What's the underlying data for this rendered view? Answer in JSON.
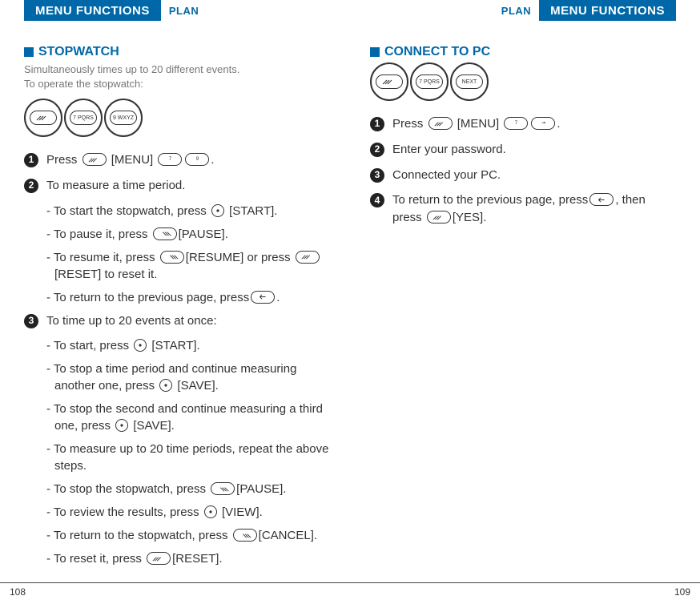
{
  "header": {
    "menu_functions": "MENU FUNCTIONS",
    "plan": "PLAN"
  },
  "left": {
    "title": "STOPWATCH",
    "intro1": "Simultaneously times up to 20 different events.",
    "intro2": "To operate the stopwatch:",
    "step1": {
      "prefix": "Press",
      "mid": "[MENU]",
      "suffix": "."
    },
    "step2": "To measure a time period.",
    "s2a_pre": "- To start the stopwatch, press ",
    "s2a_post": " [START].",
    "s2b_pre": "- To pause it, press ",
    "s2b_post": "[PAUSE].",
    "s2c_pre": "- To resume it, press ",
    "s2c_mid": "[RESUME] or press ",
    "s2c_post": "[RESET] to reset it.",
    "s2d_pre": "- To return to the previous page, press",
    "s2d_post": ".",
    "step3": "To time up to 20 events at once:",
    "s3a_pre": "- To start, press ",
    "s3a_post": " [START].",
    "s3b_pre": "- To stop a time period and continue measuring another one, press ",
    "s3b_post": " [SAVE].",
    "s3c_pre": "- To stop the second and continue measuring a third one, press ",
    "s3c_post": " [SAVE].",
    "s3d": "- To measure up to 20 time periods, repeat the above steps.",
    "s3e_pre": "- To stop the stopwatch, press ",
    "s3e_post": "[PAUSE].",
    "s3f_pre": "- To review the results, press ",
    "s3f_post": " [VIEW].",
    "s3g_pre": "- To return to the stopwatch, press ",
    "s3g_post": "[CANCEL].",
    "s3h_pre": "- To reset it, press ",
    "s3h_post": "[RESET].",
    "page_num": "108"
  },
  "right": {
    "title": "CONNECT TO PC",
    "step1": {
      "prefix": "Press",
      "mid": "[MENU]",
      "suffix": "."
    },
    "step2": "Enter your password.",
    "step3": "Connected your PC.",
    "step4_pre": "To return to the previous page, press",
    "step4_mid": ", then press",
    "step4_post": "[YES].",
    "page_num": "109"
  }
}
